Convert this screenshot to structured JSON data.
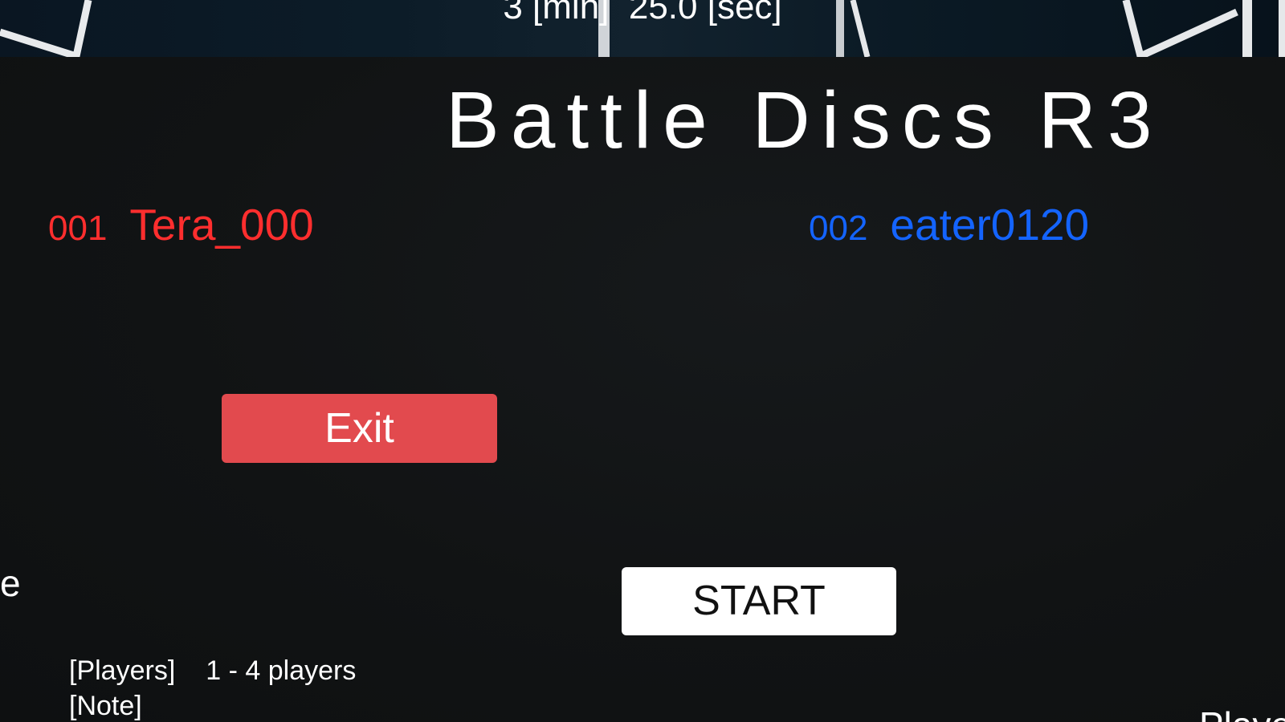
{
  "timer": {
    "minutes_text": "3 [min]",
    "seconds_text": "25.0 [sec]"
  },
  "title": "Battle Discs R3",
  "players": [
    {
      "number": "001",
      "name": "Tera_000",
      "color": "#ff2e2e"
    },
    {
      "number": "002",
      "name": "eater0120",
      "color": "#1464ff"
    }
  ],
  "buttons": {
    "exit_label": "Exit",
    "start_label": "START"
  },
  "left_edge_text": "e",
  "info": {
    "players_label": "[Players]",
    "players_value": "1 - 4 players",
    "note_label": "[Note]"
  },
  "right_edge_text": "Playe",
  "colors": {
    "background": "#101214",
    "exit_button": "#e24a4e",
    "start_button": "#ffffff"
  }
}
